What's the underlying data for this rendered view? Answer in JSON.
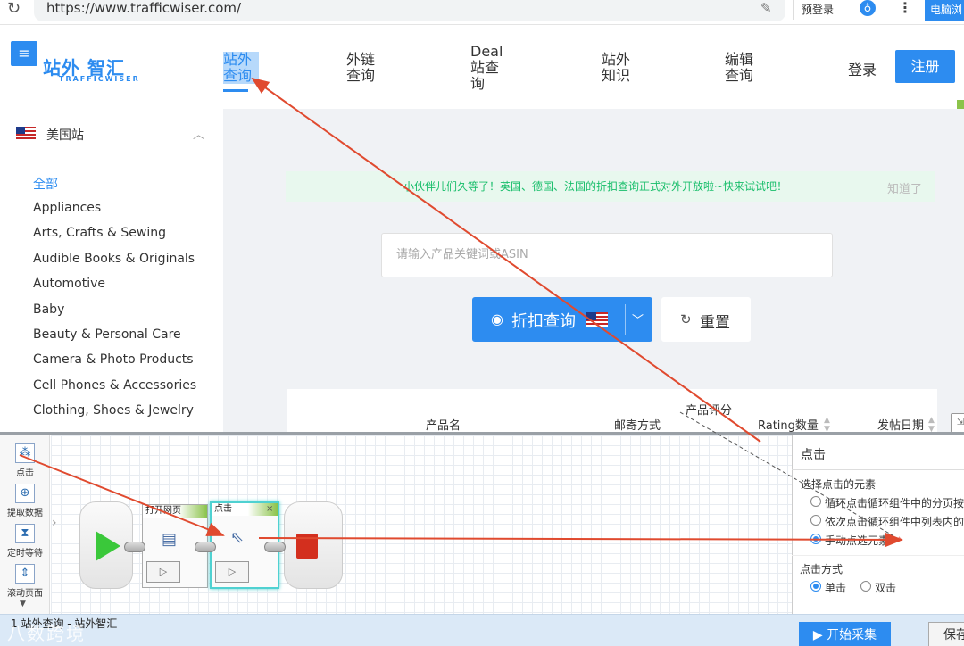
{
  "browser": {
    "url": "https://www.trafficwiser.com/",
    "prelogin_label": "预登录",
    "pc_button_label": "电脑浏"
  },
  "header": {
    "logo_text": "站外 智汇",
    "logo_sub": "TRAFFICWISER",
    "nav": [
      {
        "label": "站外\n查询"
      },
      {
        "label": "外链\n查询"
      },
      {
        "label": "Deal\n站查\n询"
      },
      {
        "label": "站外\n知识"
      },
      {
        "label": "编辑\n查询"
      }
    ],
    "login_label": "登录",
    "register_label": "注册"
  },
  "sidebar": {
    "site_name": "美国站",
    "categories": [
      "全部",
      "Appliances",
      "Arts, Crafts & Sewing",
      "Audible Books & Originals",
      "Automotive",
      "Baby",
      "Beauty & Personal Care",
      "Camera & Photo Products",
      "Cell Phones & Accessories",
      "Clothing, Shoes & Jewelry"
    ]
  },
  "main": {
    "notice_text": "小伙伴儿们久等了！英国、德国、法国的折扣查询正式对外开放啦~快来试试吧！",
    "notice_close": "知道了",
    "search_placeholder": "请输入产品关键词或ASIN",
    "search_button": "折扣查询",
    "reset_button": "重置",
    "table_headers": [
      "产品名",
      "邮寄方式",
      "产品评分",
      "Rating数量",
      "发帖日期"
    ]
  },
  "crawler": {
    "tools": [
      "点击",
      "提取数据",
      "定时等待",
      "滚动页面"
    ],
    "nodes": [
      {
        "title": "打开网页"
      },
      {
        "title": "点击"
      }
    ],
    "settings": {
      "title": "点击",
      "select_label": "选择点击的元素",
      "options": [
        "循环点击循环组件中的分页按钮",
        "依次点击循环组件中列表内的元素",
        "手动点选元素"
      ],
      "selected_option": 2,
      "click_mode_label": "点击方式",
      "click_modes": [
        "单击",
        "双击"
      ],
      "selected_mode": 0
    },
    "status_task": "1 站外查询 - 站外智汇",
    "watermark": "八数跨境",
    "start_button": "开始采集",
    "save_button": "保存"
  },
  "colors": {
    "accent": "#2d8cf0",
    "annotation_arrow": "#e04a2f",
    "notice_green": "#19be6b"
  }
}
